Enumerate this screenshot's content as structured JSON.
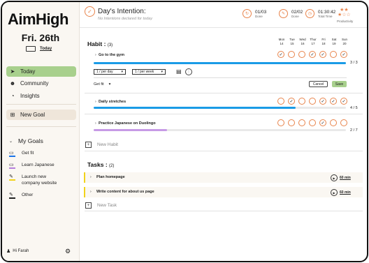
{
  "app": {
    "logo": "AimHigh"
  },
  "sidebar": {
    "date": "Fri. 26th",
    "today_link": "Today",
    "nav": [
      {
        "label": "Today",
        "icon": "send-icon"
      },
      {
        "label": "Community",
        "icon": "people-icon"
      },
      {
        "label": "Insights",
        "icon": "insights-icon"
      }
    ],
    "new_goal": "New Goal",
    "my_goals_label": "My Goals",
    "goals": [
      {
        "label": "Get fit",
        "color": "#1a73e8"
      },
      {
        "label": "Learn Japanese",
        "color": "#b57edc"
      },
      {
        "label": "Launch new company website",
        "color": "#f2d21b"
      },
      {
        "label": "Other",
        "color": "#222222"
      }
    ],
    "user": "Hi Farah"
  },
  "header": {
    "intention_title": "Day's Intention:",
    "intention_sub": "No Intentions declared for today",
    "stats": [
      {
        "value": "01/03",
        "label": "Done"
      },
      {
        "value": "02/02",
        "label": "Done"
      },
      {
        "value": "01:30:42",
        "label": "Total Time"
      }
    ],
    "productivity_label": "Productivity"
  },
  "habits": {
    "title": "Habit :",
    "count": "(3)",
    "days": [
      {
        "d": "Mon",
        "n": "14"
      },
      {
        "d": "Tue",
        "n": "15"
      },
      {
        "d": "Wed",
        "n": "16"
      },
      {
        "d": "Thur",
        "n": "17"
      },
      {
        "d": "Fri",
        "n": "18"
      },
      {
        "d": "Sat",
        "n": "19"
      },
      {
        "d": "Sun",
        "n": "20"
      }
    ],
    "items": [
      {
        "name": "Go to the gym",
        "progress": "3 / 3",
        "fraction": 1.0,
        "color": "#1a9be6",
        "checks": [
          true,
          false,
          false,
          true,
          true,
          false,
          true
        ]
      },
      {
        "name": "Daily stretches",
        "progress": "4 / 5",
        "fraction": 0.8,
        "color": "#1a9be6",
        "checks": [
          false,
          true,
          false,
          false,
          true,
          true,
          true
        ]
      },
      {
        "name": "Practice Japanese on Duolingo",
        "progress": "2 / 7",
        "fraction": 0.29,
        "color": "#c79ae6",
        "checks": [
          false,
          false,
          false,
          false,
          true,
          false,
          false
        ]
      }
    ],
    "editor": {
      "freq1": "1 / per day",
      "freq2": "1 / per week",
      "goal": "Get fit",
      "cancel": "Cancel",
      "save": "Save"
    },
    "new_habit": "New Habit"
  },
  "tasks": {
    "title": "Tasks :",
    "count": "(2)",
    "items": [
      {
        "name": "Plan homepage",
        "duration": "60 min"
      },
      {
        "name": "Write content for about us page",
        "duration": "60 min"
      }
    ],
    "new_task": "New Task"
  }
}
